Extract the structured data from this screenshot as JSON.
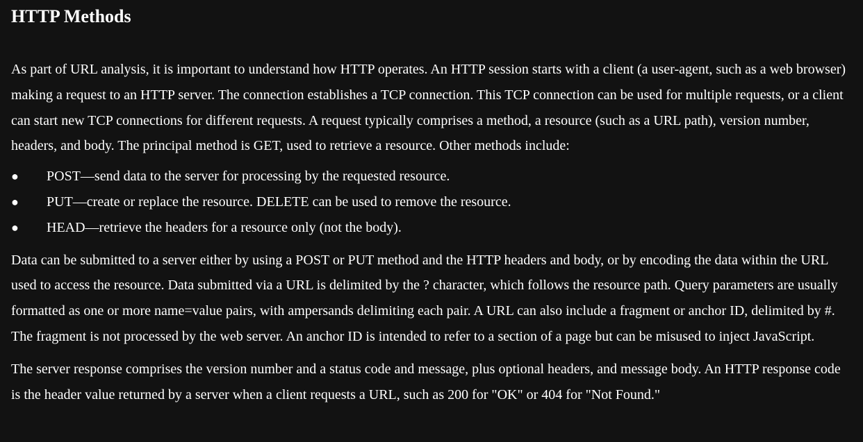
{
  "heading": "HTTP Methods",
  "paragraphs": {
    "p1": "As part of URL analysis, it is important to understand how HTTP operates. An HTTP session starts with a client (a user-agent, such as a web browser) making a request to an HTTP server. The connection establishes a TCP connection. This TCP connection can be used for multiple requests, or a client can start new TCP connections for different requests. A request typically comprises a method, a resource (such as a URL path), version number, headers, and body. The principal method is GET, used to retrieve a resource. Other methods include:",
    "p2": "Data can be submitted to a server either by using a POST or PUT method and the HTTP headers and body, or by encoding the data within the URL used to access the resource. Data submitted via a URL is delimited by the ? character, which follows the resource path. Query parameters are usually formatted as one or more name=value pairs, with ampersands delimiting each pair. A URL can also include a fragment or anchor ID, delimited by #. The fragment is not processed by the web server. An anchor ID is intended to refer to a section of a page but can be misused to inject JavaScript.",
    "p3": "The server response comprises the version number and a status code and message, plus optional headers, and message body. An HTTP response code is the header value returned by a server when a client requests a URL, such as 200 for \"OK\" or 404 for \"Not Found.\""
  },
  "bullet_glyph": "●",
  "methods_list": [
    {
      "text": "POST—send data to the server for processing by the requested resource."
    },
    {
      "text": "PUT—create or replace the resource. DELETE can be used to remove the resource."
    },
    {
      "text": "HEAD—retrieve the headers for a resource only (not the body)."
    }
  ]
}
